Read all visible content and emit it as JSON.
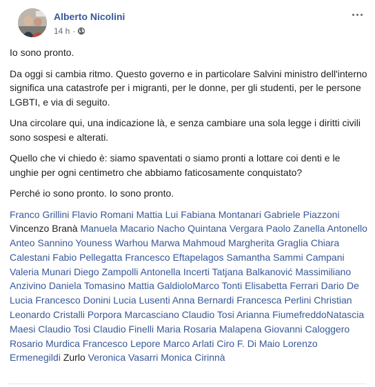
{
  "post": {
    "author": "Alberto Nicolini",
    "timestamp": "14 h",
    "separator": "·",
    "privacy_icon": "globe-icon",
    "menu_icon": "more-options-icon",
    "paragraphs": [
      "Io sono pronto.",
      "Da oggi si cambia ritmo. Questo governo e in particolare Salvini ministro dell'interno significa una catastrofe per i migranti, per le donne, per gli studenti, per le persone LGBTI, e via di seguito.",
      "Una circolare qui, una indicazione là, e senza cambiare una sola legge i diritti civili sono sospesi e alterati.",
      "Quello che vi chiedo è: siamo spaventati o siamo pronti a lottare coi denti e le unghie per ogni centimetro che abbiamo faticosamente conquistato?",
      "Perché io sono pronto. Io sono pronto."
    ],
    "tags": [
      {
        "name": "Franco Grillini",
        "linked": true
      },
      {
        "name": "Flavio Romani",
        "linked": true
      },
      {
        "name": "Mattia Lui",
        "linked": true
      },
      {
        "name": "Fabiana Montanari",
        "linked": true
      },
      {
        "name": "Gabriele Piazzoni",
        "linked": true
      },
      {
        "name": "Vincenzo Branà",
        "linked": false
      },
      {
        "name": "Manuela Macario",
        "linked": true
      },
      {
        "name": "Nacho Quintana Vergara",
        "linked": true
      },
      {
        "name": "Paolo Zanella",
        "linked": true
      },
      {
        "name": "Antonello Anteo Sannino",
        "linked": true
      },
      {
        "name": "Youness Warhou",
        "linked": true
      },
      {
        "name": "Marwa Mahmoud",
        "linked": true
      },
      {
        "name": "Margherita Graglia",
        "linked": true
      },
      {
        "name": "Chiara Calestani",
        "linked": true
      },
      {
        "name": "Fabio Pellegatta",
        "linked": true
      },
      {
        "name": "Francesco Eftapelagos Samantha",
        "linked": true
      },
      {
        "name": "Sammi Campani",
        "linked": true
      },
      {
        "name": "Valeria Munari",
        "linked": true
      },
      {
        "name": "Diego Zampolli",
        "linked": true
      },
      {
        "name": "Antonella Incerti",
        "linked": true
      },
      {
        "name": "Tatjana Balkanović",
        "linked": true
      },
      {
        "name": "Massimiliano Anzivino",
        "linked": true
      },
      {
        "name": "Daniela Tomasino",
        "linked": true
      },
      {
        "name": "Mattia GaldioloMarco",
        "linked": true
      },
      {
        "name": "Tonti",
        "linked": true
      },
      {
        "name": "Elisabetta Ferrari",
        "linked": true
      },
      {
        "name": "Dario De Lucia",
        "linked": true
      },
      {
        "name": "Francesco Donini",
        "linked": true
      },
      {
        "name": "Lucia Lusenti",
        "linked": true
      },
      {
        "name": "Anna Bernardi",
        "linked": true
      },
      {
        "name": "Francesca Perlini",
        "linked": true
      },
      {
        "name": "Christian Leonardo Cristalli",
        "linked": true
      },
      {
        "name": "Porpora Marcasciano",
        "linked": true
      },
      {
        "name": "Claudio Tosi",
        "linked": true
      },
      {
        "name": "Arianna FiumefreddoNatascia",
        "linked": true
      },
      {
        "name": "Maesi",
        "linked": true
      },
      {
        "name": "Claudio Tosi",
        "linked": true
      },
      {
        "name": "Claudio Finelli",
        "linked": true
      },
      {
        "name": "Maria Rosaria Malapena",
        "linked": true
      },
      {
        "name": "Giovanni Caloggero Rosario Murdica",
        "linked": true
      },
      {
        "name": "Francesco Lepore",
        "linked": true
      },
      {
        "name": "Marco Arlati",
        "linked": true
      },
      {
        "name": "Ciro F. Di Maio",
        "linked": true
      },
      {
        "name": "Lorenzo Ermenegildi",
        "linked": true
      },
      {
        "name": "Zurlo",
        "linked": false
      },
      {
        "name": "Veronica Vasarri",
        "linked": true
      },
      {
        "name": "Monica Cirinnà",
        "linked": true
      }
    ]
  },
  "colors": {
    "link": "#385898",
    "text": "#1c1e21",
    "meta": "#606770"
  }
}
